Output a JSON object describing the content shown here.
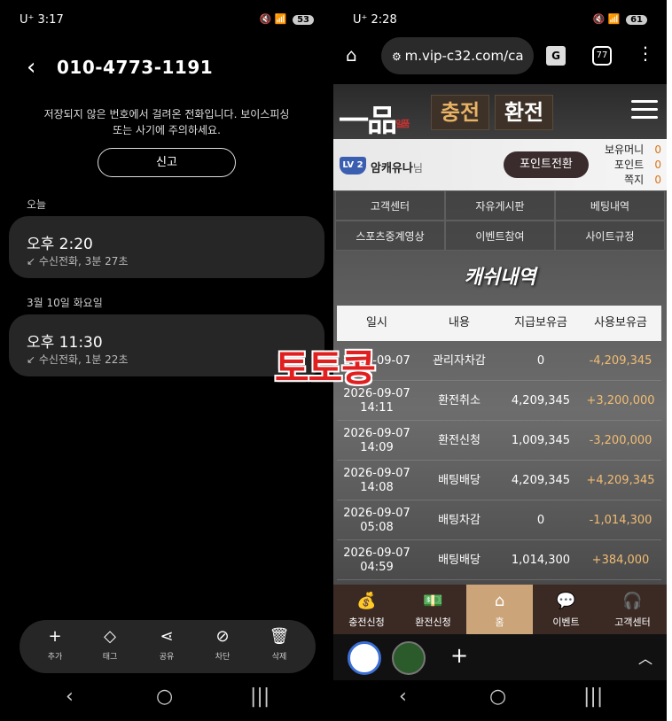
{
  "left": {
    "status": {
      "time": "3:17",
      "carrier": "U⁺",
      "battery": "53",
      "icons": "◀◆"
    },
    "header": {
      "back_icon": "‹",
      "phone_number": "010-4773-1191"
    },
    "warning": {
      "line1": "저장되지 않은 번호에서 걸려온 전화입니다. 보이스피싱",
      "line2": "또는 사기에 주의하세요."
    },
    "report_label": "신고",
    "sections": [
      {
        "label": "오늘",
        "call_time": "오후 2:20",
        "call_info": "수신전화, 3분 27초"
      },
      {
        "label": "3월 10일 화요일",
        "call_time": "오후 11:30",
        "call_info": "수신전화, 1분 22초"
      }
    ],
    "toolbar": [
      {
        "icon": "+",
        "label": "추가"
      },
      {
        "icon": "◇",
        "label": "태그"
      },
      {
        "icon": "⋖",
        "label": "공유"
      },
      {
        "icon": "⃠",
        "label": "차단"
      },
      {
        "icon": "🗑",
        "label": "삭제"
      }
    ]
  },
  "right": {
    "status": {
      "time": "2:28",
      "carrier": "U⁺",
      "battery": "61"
    },
    "browser": {
      "url": "m.vip-c32.com/ca",
      "tab_count": "77"
    },
    "site": {
      "logo": "一品",
      "logo_small": "일품",
      "charge": "충전",
      "exchange": "환전",
      "level": "LV 2",
      "username": "암캐유나",
      "username_suffix": "님",
      "point_convert": "포인트전환",
      "balance_labels": [
        "보유머니",
        "포인트",
        "쪽지"
      ],
      "balance_values": [
        "0",
        "0",
        "0"
      ],
      "links": [
        "고객센터",
        "자유게시판",
        "베팅내역",
        "스포츠중계영상",
        "이벤트참여",
        "사이트규정"
      ],
      "cash_title": "캐쉬내역",
      "table_headers": [
        "일시",
        "내용",
        "지급보유금",
        "사용보유금"
      ],
      "rows": [
        {
          "date": "2026-09-07",
          "time": "",
          "content": "관리자차감",
          "paid": "0",
          "used": "-4,209,345"
        },
        {
          "date": "2026-09-07",
          "time": "14:11",
          "content": "환전취소",
          "paid": "4,209,345",
          "used": "+3,200,000"
        },
        {
          "date": "2026-09-07",
          "time": "14:09",
          "content": "환전신청",
          "paid": "1,009,345",
          "used": "-3,200,000"
        },
        {
          "date": "2026-09-07",
          "time": "14:08",
          "content": "배팅배당",
          "paid": "4,209,345",
          "used": "+4,209,345"
        },
        {
          "date": "2026-09-07",
          "time": "05:08",
          "content": "배팅차감",
          "paid": "0",
          "used": "-1,014,300"
        },
        {
          "date": "2026-09-07",
          "time": "04:59",
          "content": "배팅배당",
          "paid": "1,014,300",
          "used": "+384,000"
        }
      ],
      "bottom_nav": [
        "충전신청",
        "환전신청",
        "홈",
        "이벤트",
        "고객센터"
      ]
    },
    "watermark": "토토콩"
  }
}
